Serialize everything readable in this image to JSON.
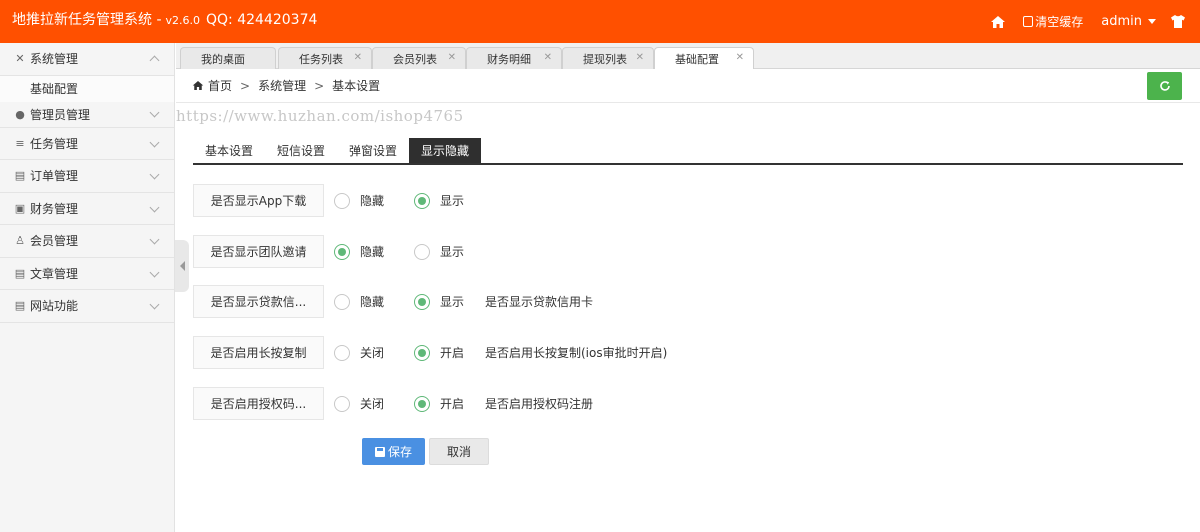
{
  "header": {
    "title": "地推拉新任务管理系统 -",
    "version": "v2.6.0",
    "qq": "QQ: 424420374",
    "clear_cache": "清空缓存",
    "user": "admin"
  },
  "sidebar": {
    "items": [
      {
        "label": "系统管理",
        "icon": "tools-icon",
        "expanded": true
      },
      {
        "label": "管理员管理",
        "icon": "user-icon"
      },
      {
        "label": "任务管理",
        "icon": "database-icon"
      },
      {
        "label": "订单管理",
        "icon": "table-icon"
      },
      {
        "label": "财务管理",
        "icon": "finance-icon"
      },
      {
        "label": "会员管理",
        "icon": "member-icon"
      },
      {
        "label": "文章管理",
        "icon": "article-icon"
      },
      {
        "label": "网站功能",
        "icon": "site-icon"
      }
    ],
    "sub_items": [
      {
        "label": "基础配置"
      }
    ]
  },
  "tabs": [
    {
      "label": "我的桌面",
      "closable": false
    },
    {
      "label": "任务列表",
      "closable": true
    },
    {
      "label": "会员列表",
      "closable": true
    },
    {
      "label": "财务明细",
      "closable": true
    },
    {
      "label": "提现列表",
      "closable": true
    },
    {
      "label": "基础配置",
      "closable": true,
      "active": true
    }
  ],
  "breadcrumb": [
    "首页",
    "系统管理",
    "基本设置"
  ],
  "watermark": "https://www.huzhan.com/ishop4765",
  "subtabs": [
    {
      "label": "基本设置"
    },
    {
      "label": "短信设置"
    },
    {
      "label": "弹窗设置"
    },
    {
      "label": "显示隐藏",
      "active": true
    }
  ],
  "form": {
    "rows": [
      {
        "label": "是否显示App下载",
        "opt1": "隐藏",
        "opt2": "显示",
        "selected": 2,
        "desc": ""
      },
      {
        "label": "是否显示团队邀请",
        "opt1": "隐藏",
        "opt2": "显示",
        "selected": 1,
        "desc": ""
      },
      {
        "label": "是否显示贷款信...",
        "opt1": "隐藏",
        "opt2": "显示",
        "selected": 2,
        "desc": "是否显示贷款信用卡"
      },
      {
        "label": "是否启用长按复制",
        "opt1": "关闭",
        "opt2": "开启",
        "selected": 2,
        "desc": "是否启用长按复制(ios审批时开启)"
      },
      {
        "label": "是否启用授权码...",
        "opt1": "关闭",
        "opt2": "开启",
        "selected": 2,
        "desc": "是否启用授权码注册"
      }
    ],
    "save_label": "保存",
    "cancel_label": "取消"
  },
  "colors": {
    "header_bg": "#ff5000",
    "radio_on": "#5fb878",
    "save_btn": "#4a90e2",
    "refresh_btn": "#4cb34c"
  }
}
